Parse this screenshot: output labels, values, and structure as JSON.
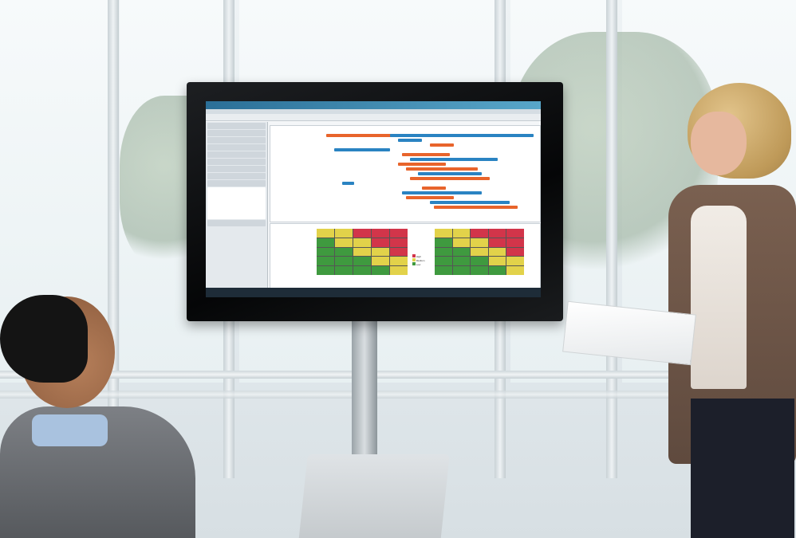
{
  "scene": {
    "description_free": true,
    "colors": {
      "gantt_blue": "#2a83c2",
      "gantt_orange": "#e8642b",
      "heat_green": "#3f9a3f",
      "heat_yellow": "#e2d24a",
      "heat_red": "#d2354a"
    }
  },
  "monitor_screen": {
    "legend": [
      {
        "label": "High",
        "color": "#d2354a"
      },
      {
        "label": "Medium",
        "color": "#e2d24a"
      },
      {
        "label": "Low",
        "color": "#3f9a3f"
      }
    ]
  }
}
